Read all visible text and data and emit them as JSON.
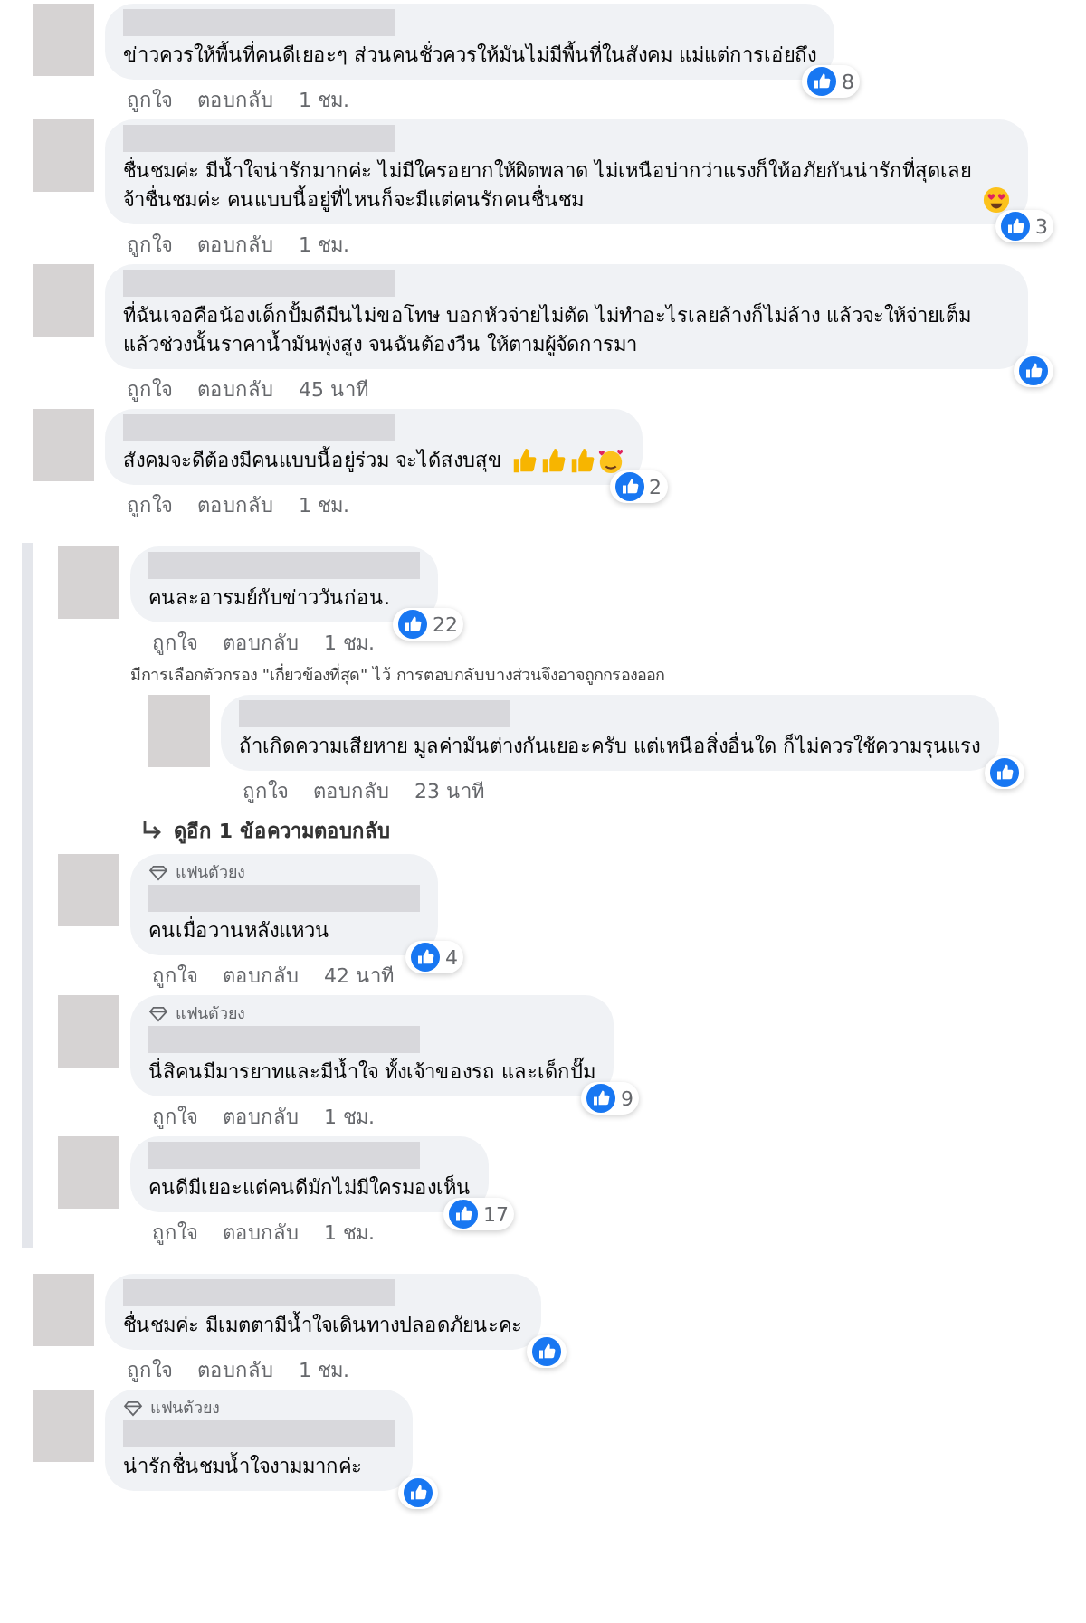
{
  "groups": [
    {
      "threaded": false,
      "comments": [
        {
          "text": "ข่าวควรให้พื้นที่คนดีเยอะๆ ส่วนคนชั่วควรให้มันไม่มีพื้นที่ในสังคม แม่แต่การเอ่ยถึง",
          "reaction_count": "8",
          "actions": [
            "ถูกใจ",
            "ตอบกลับ"
          ],
          "time": "1 ชม."
        },
        {
          "text": "ชื่นชมค่ะ มีน้ำใจน่ารักมากค่ะ ไม่มีใครอยากให้ผิดพลาด ไม่เหนือบ่ากว่าแรงก็ให้อภัยกันน่ารักที่สุดเลยจ้าชื่นชมค่ะ คนแบบนี้อยู่ที่ไหนก็จะมีแต่คนรักคนชื่นชม",
          "emojis": [
            {
              "kind": "heart-eyes"
            }
          ],
          "reaction_count": "3",
          "actions": [
            "ถูกใจ",
            "ตอบกลับ"
          ],
          "time": "1 ชม."
        },
        {
          "text": "ที่ฉันเจอคือน้องเด็กปั้มดีมีนไม่ขอโทษ บอกหัวจ่ายไม่ตัด ไม่ทำอะไรเลยล้างก็ไม่ล้าง แล้วจะให้จ่ายเต็ม แล้วช่วงนั้นราคาน้ำมันพุ่งสูง จนฉันต้องวีน ให้ตามผู้จัดการมา",
          "actions": [
            "ถูกใจ",
            "ตอบกลับ"
          ],
          "time": "45 นาที"
        },
        {
          "text": "สังคมจะดีต้องมีคนแบบนี้อยู่ร่วม จะได้สงบสุข",
          "emojis": [
            {
              "kind": "thumbs-up"
            },
            {
              "kind": "thumbs-up"
            },
            {
              "kind": "thumbs-up"
            },
            {
              "kind": "hearts-face"
            }
          ],
          "reaction_count": "2",
          "actions": [
            "ถูกใจ",
            "ตอบกลับ"
          ],
          "time": "1 ชม."
        }
      ]
    },
    {
      "threaded": true,
      "comments": [
        {
          "text": "คนละอารมย์กับข่าววันก่อน.",
          "reaction_count": "22",
          "actions": [
            "ถูกใจ",
            "ตอบกลับ"
          ],
          "time": "1 ชม.",
          "filter_note": "มีการเลือกตัวกรอง \"เกี่ยวข้องที่สุด\" ไว้ การตอบกลับบางส่วนจึงอาจถูกกรองออก",
          "replies": [
            {
              "text": "ถ้าเกิดความเสียหาย มูลค่ามันต่างกันเยอะครับ แต่เหนือสิ่งอื่นใด ก็ไม่ควรใช้ความรุนแรง",
              "actions": [
                "ถูกใจ",
                "ตอบกลับ"
              ],
              "time": "23 นาที"
            }
          ],
          "more_replies": "ดูอีก 1 ข้อความตอบกลับ"
        },
        {
          "badge": "แฟนตัวยง",
          "text": "คนเมื่อวานหลังแหวน",
          "reaction_count": "4",
          "actions": [
            "ถูกใจ",
            "ตอบกลับ"
          ],
          "time": "42 นาที"
        },
        {
          "badge": "แฟนตัวยง",
          "text": "นี่สิคนมีมารยาทและมีน้ำใจ ทั้งเจ้าของรถ และเด็กปั๊ม",
          "reaction_count": "9",
          "actions": [
            "ถูกใจ",
            "ตอบกลับ"
          ],
          "time": "1 ชม."
        },
        {
          "text": "คนดีมีเยอะแต่คนดีมักไม่มีใครมองเห็น",
          "reaction_count": "17",
          "actions": [
            "ถูกใจ",
            "ตอบกลับ"
          ],
          "time": "1 ชม."
        }
      ]
    },
    {
      "threaded": false,
      "comments": [
        {
          "text": "ชื่นชมค่ะ มีเมตตามีน้ำใจเดินทางปลอดภัยนะคะ",
          "actions": [
            "ถูกใจ",
            "ตอบกลับ"
          ],
          "time": "1 ชม."
        },
        {
          "badge": "แฟนตัวยง",
          "text": "น่ารักชื่นชมน้ำใจงามมากค่ะ"
        }
      ]
    }
  ]
}
